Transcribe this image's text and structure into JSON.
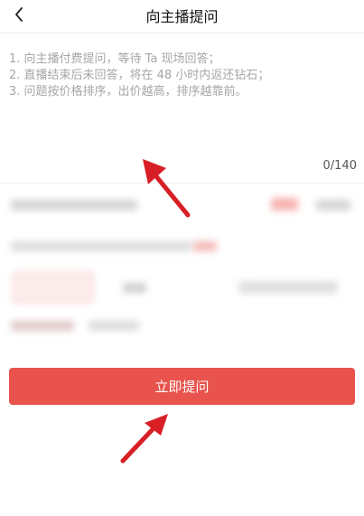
{
  "header": {
    "title": "向主播提问",
    "back_icon": "chevron-left-icon"
  },
  "question": {
    "placeholder": "1. 向主播付费提问，等待 Ta 现场回答；\n2. 直播结束后未回答，将在 48 小时内返还钻石；\n3. 问题按价格排序，出价越高，排序越靠前。",
    "value": "",
    "counter": "0/140"
  },
  "submit": {
    "label": "立即提问"
  },
  "colors": {
    "accent": "#e8534d",
    "annotation_arrow": "#d81f26"
  }
}
